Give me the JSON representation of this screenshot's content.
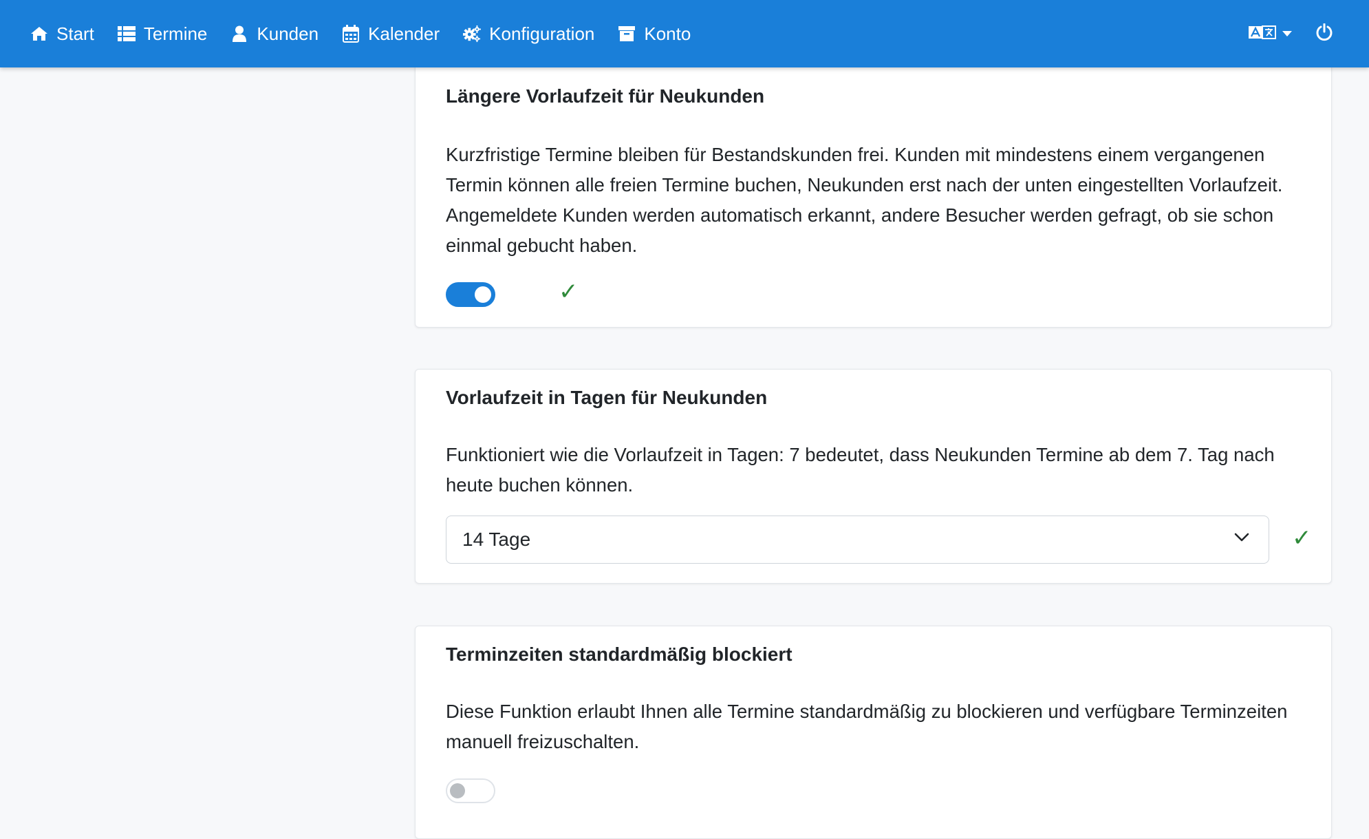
{
  "navbar": {
    "items": [
      {
        "label": "Start",
        "icon": "home-icon"
      },
      {
        "label": "Termine",
        "icon": "list-icon"
      },
      {
        "label": "Kunden",
        "icon": "user-icon"
      },
      {
        "label": "Kalender",
        "icon": "calendar-icon"
      },
      {
        "label": "Konfiguration",
        "icon": "gears-icon"
      },
      {
        "label": "Konto",
        "icon": "archive-icon"
      }
    ],
    "right": {
      "language_icon": "language-icon",
      "power_icon": "power-icon"
    },
    "color": "#1a7fd9"
  },
  "settings": {
    "new_customer_lead": {
      "title": "Längere Vorlaufzeit für Neukunden",
      "description": "Kurzfristige Termine bleiben für Bestandskunden frei. Kunden mit mindestens einem vergangenen Termin können alle freien Termine buchen, Neukunden erst nach der unten eingestellten Vorlaufzeit. Angemeldete Kunden werden automatisch erkannt, andere Besucher werden gefragt, ob sie schon einmal gebucht haben.",
      "enabled": true,
      "saved_mark": "✓"
    },
    "lead_days": {
      "title": "Vorlaufzeit in Tagen für Neukunden",
      "description": "Funktioniert wie die Vorlaufzeit in Tagen: 7 bedeutet, dass Neukunden Termine ab dem 7. Tag nach heute buchen können.",
      "selected": "14 Tage",
      "saved_mark": "✓"
    },
    "blocked_default": {
      "title": "Terminzeiten standardmäßig blockiert",
      "description": "Diese Funktion erlaubt Ihnen alle Termine standardmäßig zu blockieren und verfügbare Terminzeiten manuell freizuschalten.",
      "enabled": false
    }
  },
  "colors": {
    "accent": "#1a7fd9",
    "success": "#2f8a3a"
  }
}
